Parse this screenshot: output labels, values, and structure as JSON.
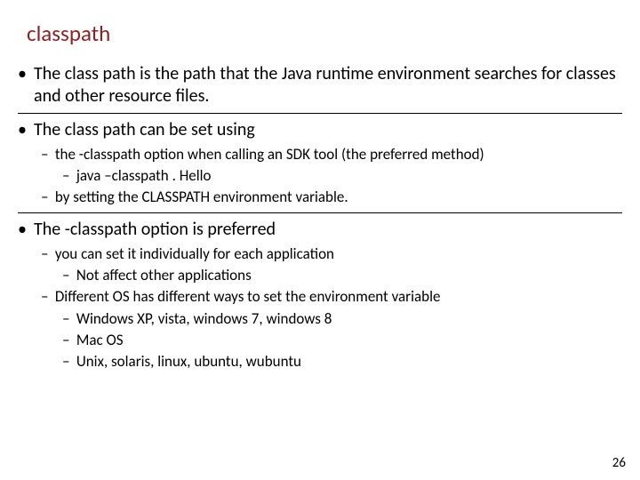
{
  "title": "classpath",
  "b1": {
    "text": "The class path is the path that the Java runtime environment searches for classes and other resource files."
  },
  "b2": {
    "text": "The class path can be set using",
    "sub": [
      "the -classpath option when calling an SDK tool (the preferred method)",
      "java –classpath . Hello",
      "by setting the CLASSPATH environment variable."
    ]
  },
  "b3": {
    "text": "The -classpath option is preferred",
    "sub": [
      "you can set it individually for each application",
      "Not affect other applications",
      "Different OS has different ways to set the environment variable",
      "Windows  XP, vista, windows 7, windows 8",
      "Mac OS",
      "Unix, solaris, linux, ubuntu, wubuntu"
    ]
  },
  "page_number": "26"
}
